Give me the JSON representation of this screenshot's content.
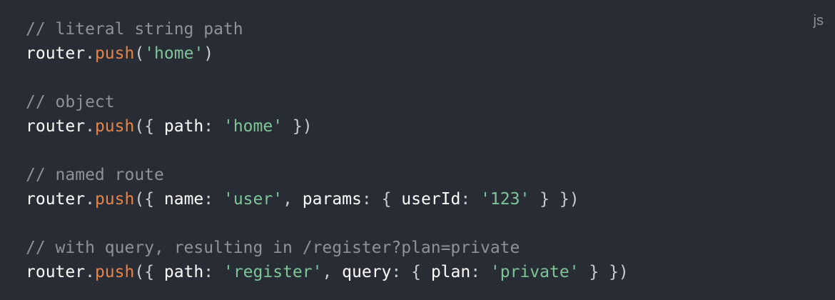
{
  "code_block": {
    "language_label": "js",
    "lines": [
      {
        "comment": "// literal string path"
      },
      {
        "tokens": [
          {
            "type": "plain",
            "text": "router"
          },
          {
            "type": "punc",
            "text": "."
          },
          {
            "type": "func",
            "text": "push"
          },
          {
            "type": "punc",
            "text": "("
          },
          {
            "type": "str",
            "text": "'home'"
          },
          {
            "type": "punc",
            "text": ")"
          }
        ]
      },
      {
        "blank": true
      },
      {
        "comment": "// object"
      },
      {
        "tokens": [
          {
            "type": "plain",
            "text": "router"
          },
          {
            "type": "punc",
            "text": "."
          },
          {
            "type": "func",
            "text": "push"
          },
          {
            "type": "punc",
            "text": "({ "
          },
          {
            "type": "plain",
            "text": "path"
          },
          {
            "type": "punc",
            "text": ": "
          },
          {
            "type": "str",
            "text": "'home'"
          },
          {
            "type": "punc",
            "text": " })"
          }
        ]
      },
      {
        "blank": true
      },
      {
        "comment": "// named route"
      },
      {
        "tokens": [
          {
            "type": "plain",
            "text": "router"
          },
          {
            "type": "punc",
            "text": "."
          },
          {
            "type": "func",
            "text": "push"
          },
          {
            "type": "punc",
            "text": "({ "
          },
          {
            "type": "plain",
            "text": "name"
          },
          {
            "type": "punc",
            "text": ": "
          },
          {
            "type": "str",
            "text": "'user'"
          },
          {
            "type": "punc",
            "text": ", "
          },
          {
            "type": "plain",
            "text": "params"
          },
          {
            "type": "punc",
            "text": ": { "
          },
          {
            "type": "plain",
            "text": "userId"
          },
          {
            "type": "punc",
            "text": ": "
          },
          {
            "type": "str",
            "text": "'123'"
          },
          {
            "type": "punc",
            "text": " } })"
          }
        ]
      },
      {
        "blank": true
      },
      {
        "comment": "// with query, resulting in /register?plan=private"
      },
      {
        "tokens": [
          {
            "type": "plain",
            "text": "router"
          },
          {
            "type": "punc",
            "text": "."
          },
          {
            "type": "func",
            "text": "push"
          },
          {
            "type": "punc",
            "text": "({ "
          },
          {
            "type": "plain",
            "text": "path"
          },
          {
            "type": "punc",
            "text": ": "
          },
          {
            "type": "str",
            "text": "'register'"
          },
          {
            "type": "punc",
            "text": ", "
          },
          {
            "type": "plain",
            "text": "query"
          },
          {
            "type": "punc",
            "text": ": { "
          },
          {
            "type": "plain",
            "text": "plan"
          },
          {
            "type": "punc",
            "text": ": "
          },
          {
            "type": "str",
            "text": "'private'"
          },
          {
            "type": "punc",
            "text": " } })"
          }
        ]
      }
    ],
    "colors": {
      "background": "#282c34",
      "comment": "#8d929b",
      "function": "#e5844a",
      "string": "#7ec699",
      "plain": "#ffffff"
    }
  }
}
